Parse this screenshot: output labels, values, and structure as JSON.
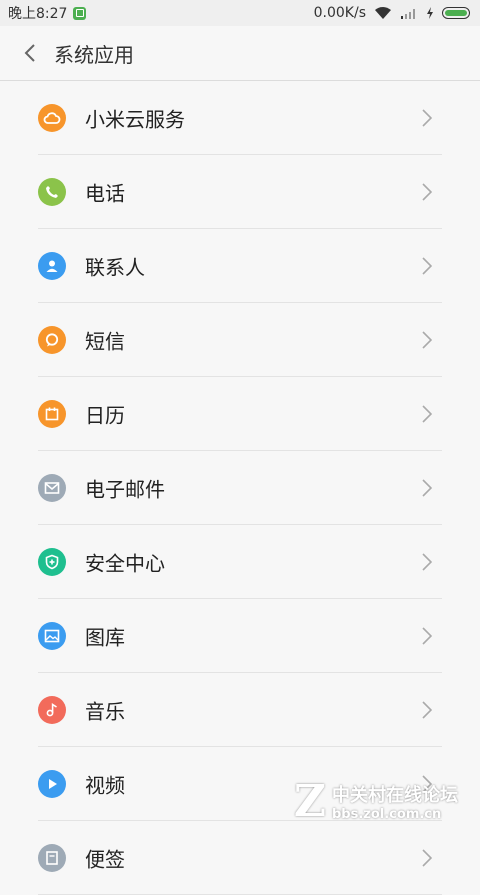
{
  "status_bar": {
    "time": "晚上8:27",
    "speed": "0.00K/s"
  },
  "header": {
    "title": "系统应用"
  },
  "colors": {
    "cloud": "#f7952b",
    "phone": "#8bc34a",
    "contacts": "#3b9cf0",
    "sms": "#f7952b",
    "calendar": "#f7952b",
    "email": "#9eaab6",
    "security": "#1fbf8f",
    "gallery": "#3b9cf0",
    "music": "#f26b5b",
    "video": "#3b9cf0",
    "notes": "#9eaab6"
  },
  "items": [
    {
      "label": "小米云服务",
      "icon": "cloud-icon"
    },
    {
      "label": "电话",
      "icon": "phone-icon"
    },
    {
      "label": "联系人",
      "icon": "contacts-icon"
    },
    {
      "label": "短信",
      "icon": "sms-icon"
    },
    {
      "label": "日历",
      "icon": "calendar-icon"
    },
    {
      "label": "电子邮件",
      "icon": "email-icon"
    },
    {
      "label": "安全中心",
      "icon": "security-icon"
    },
    {
      "label": "图库",
      "icon": "gallery-icon"
    },
    {
      "label": "音乐",
      "icon": "music-icon"
    },
    {
      "label": "视频",
      "icon": "video-icon"
    },
    {
      "label": "便签",
      "icon": "notes-icon"
    }
  ],
  "watermark": {
    "title": "中关村在线论坛",
    "url": "bbs.zol.com.cn"
  }
}
